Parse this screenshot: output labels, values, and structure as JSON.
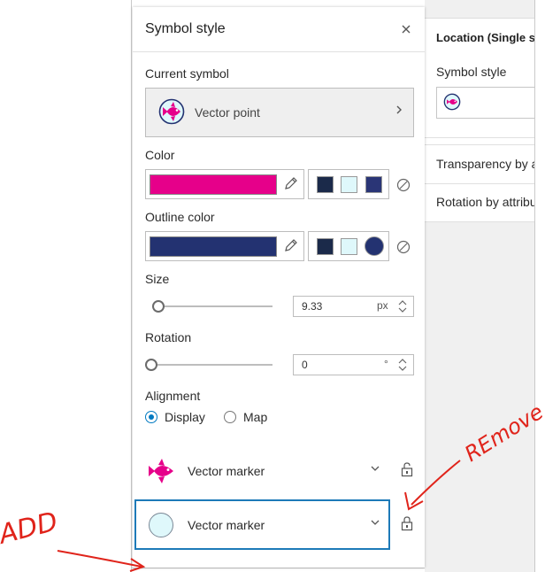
{
  "panel": {
    "title": "Symbol style",
    "close_icon": "close-icon"
  },
  "current_symbol": {
    "label": "Current symbol",
    "name": "Vector point",
    "icon": "fish-symbol-icon"
  },
  "color": {
    "label": "Color",
    "value": "#e6008a",
    "recent": [
      "#1b2a4a",
      "#dff8fb",
      "#2a3576"
    ]
  },
  "outline_color": {
    "label": "Outline color",
    "value": "#233271",
    "recent": [
      "#1b2a4a",
      "#dff8fb",
      "#233271"
    ]
  },
  "size": {
    "label": "Size",
    "value": "9.33",
    "unit": "px"
  },
  "rotation": {
    "label": "Rotation",
    "value": "0",
    "unit": "°"
  },
  "alignment": {
    "label": "Alignment",
    "options": [
      "Display",
      "Map"
    ],
    "selected": "Display"
  },
  "layers": [
    {
      "label": "Vector marker",
      "icon": "fish-icon"
    },
    {
      "label": "Vector marker",
      "icon": "circle-icon"
    }
  ],
  "right_panel": {
    "title": "Location (Single s",
    "symbol_style_label": "Symbol style",
    "rows": [
      "Transparency by a",
      "Rotation by attribu"
    ]
  },
  "annotations": {
    "remove": "REmove",
    "add": "ADD"
  },
  "colors": {
    "accent": "#0079c1",
    "annotation_red": "#e0241b",
    "selected_border": "#1d7ab8"
  }
}
